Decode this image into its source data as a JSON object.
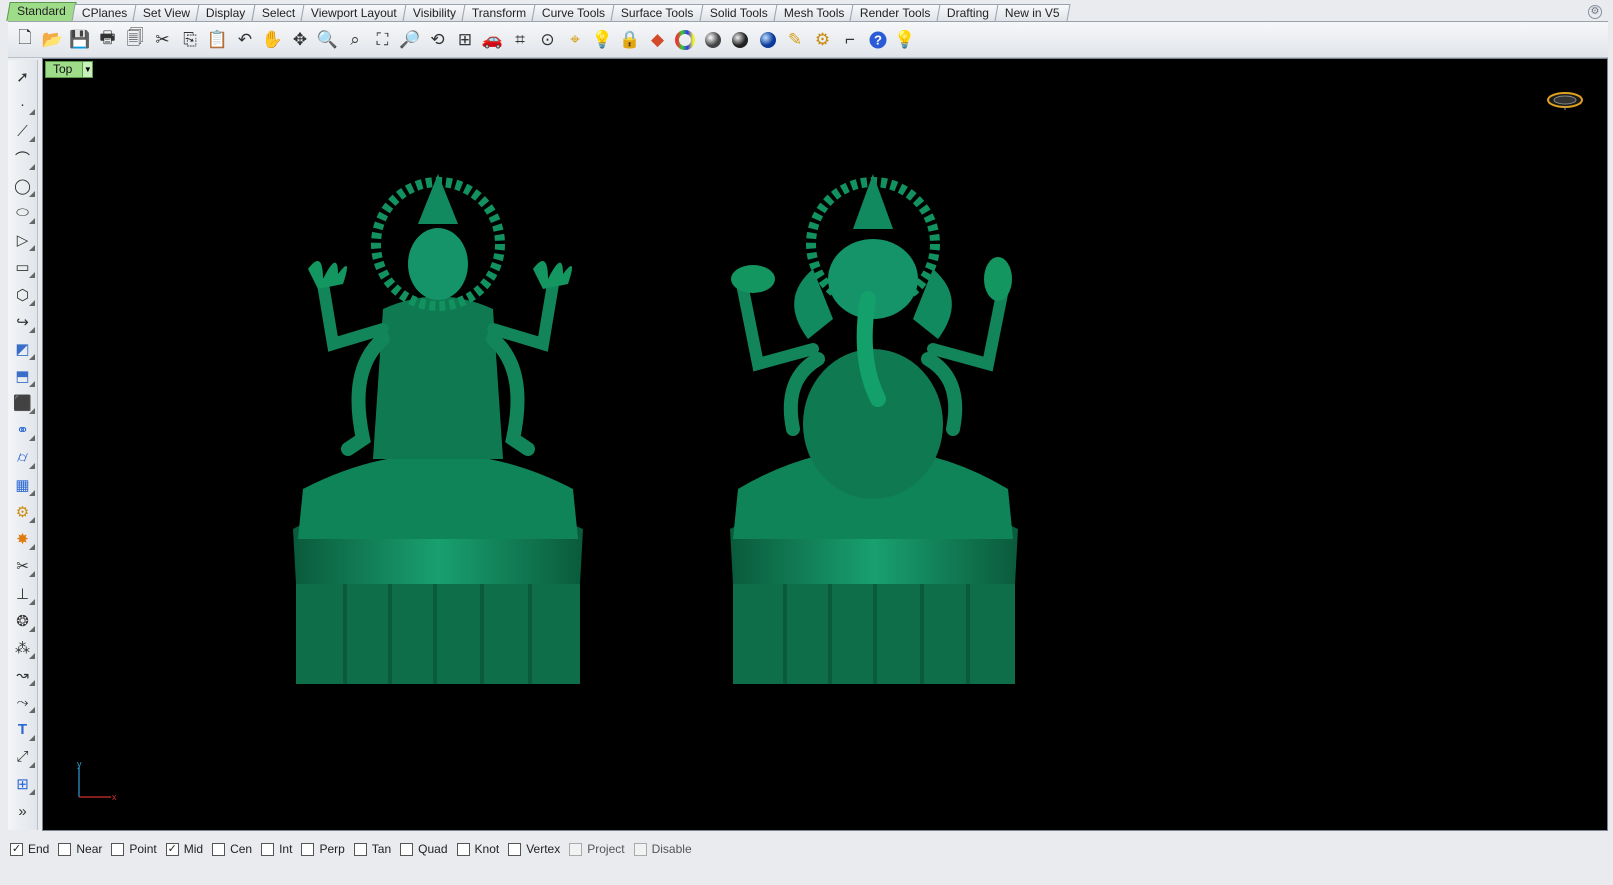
{
  "tabs": [
    {
      "label": "Standard",
      "active": true
    },
    {
      "label": "CPlanes"
    },
    {
      "label": "Set View"
    },
    {
      "label": "Display"
    },
    {
      "label": "Select"
    },
    {
      "label": "Viewport Layout"
    },
    {
      "label": "Visibility"
    },
    {
      "label": "Transform"
    },
    {
      "label": "Curve Tools"
    },
    {
      "label": "Surface Tools"
    },
    {
      "label": "Solid Tools"
    },
    {
      "label": "Mesh Tools"
    },
    {
      "label": "Render Tools"
    },
    {
      "label": "Drafting"
    },
    {
      "label": "New in V5"
    }
  ],
  "toolbar": {
    "icons": [
      "new-file-icon",
      "open-folder-icon",
      "save-icon",
      "print-icon",
      "import-icon",
      "cut-icon",
      "copy-icon",
      "paste-icon",
      "undo-icon",
      "pan-hand-icon",
      "rotate-view-icon",
      "zoom-icon",
      "zoom-window-icon",
      "zoom-extents-icon",
      "zoom-selected-icon",
      "zoom-previous-icon",
      "four-viewports-icon",
      "car-icon",
      "grid-icon",
      "snap-icon",
      "osnap-icon",
      "light-bulb-icon",
      "lock-icon",
      "layer-icon",
      "color-wheel-icon",
      "shaded-sphere-icon",
      "rendered-sphere-icon",
      "blue-sphere-icon",
      "render-icon",
      "settings-gear-icon",
      "dimension-icon",
      "help-icon",
      "hint-icon"
    ]
  },
  "sidebar": {
    "icons": [
      "select-arrow-icon",
      "point-icon",
      "polyline-icon",
      "curve-icon",
      "circle-icon",
      "ellipse-icon",
      "polygon-icon",
      "rectangle-icon",
      "arc-icon",
      "fillet-icon",
      "surface-icon",
      "extrude-icon",
      "box-icon",
      "sphere-icon",
      "cylinder-icon",
      "mesh-icon",
      "gear-icon",
      "explode-icon",
      "trim-icon",
      "split-icon",
      "boolean-icon",
      "array-icon",
      "offset-icon",
      "blend-icon",
      "text-icon",
      "transform-icon",
      "group-icon",
      "more-icon"
    ]
  },
  "viewport": {
    "title": "Top",
    "axis_y": "y",
    "axis_x": "x",
    "background": "#000000",
    "model_color": "#0f7a52"
  },
  "statusbar": {
    "snaps": [
      {
        "label": "End",
        "checked": true
      },
      {
        "label": "Near",
        "checked": false
      },
      {
        "label": "Point",
        "checked": false
      },
      {
        "label": "Mid",
        "checked": true
      },
      {
        "label": "Cen",
        "checked": false
      },
      {
        "label": "Int",
        "checked": false
      },
      {
        "label": "Perp",
        "checked": false
      },
      {
        "label": "Tan",
        "checked": false
      },
      {
        "label": "Quad",
        "checked": false
      },
      {
        "label": "Knot",
        "checked": false
      },
      {
        "label": "Vertex",
        "checked": false
      },
      {
        "label": "Project",
        "checked": false,
        "disabled": true
      },
      {
        "label": "Disable",
        "checked": false,
        "disabled": true
      }
    ]
  }
}
